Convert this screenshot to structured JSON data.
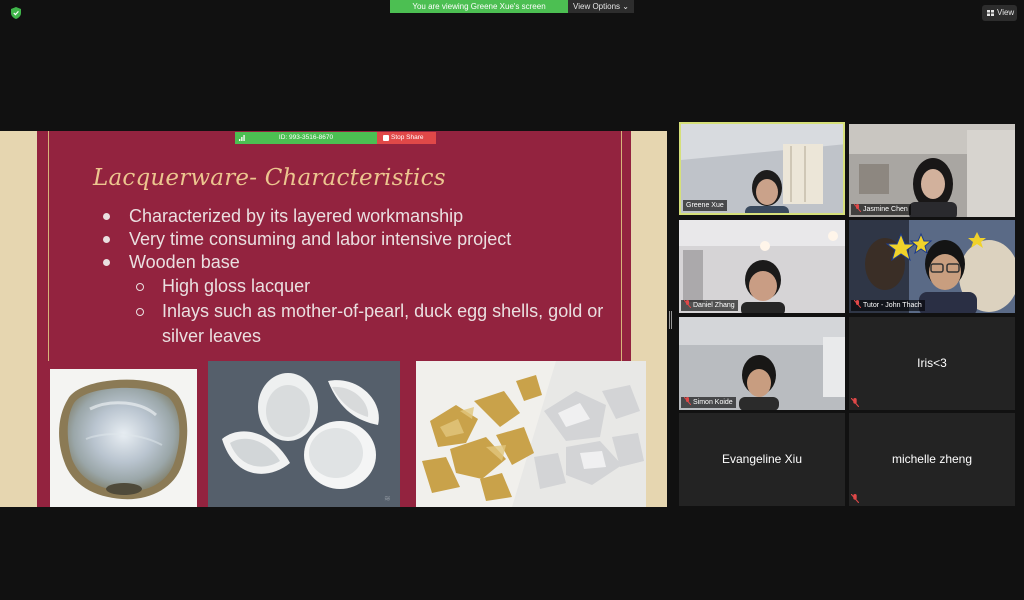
{
  "window": {
    "viewing_banner": "You are viewing Greene Xue's screen",
    "view_options_label": "View Options",
    "view_button_label": "View"
  },
  "share_toolbar": {
    "meeting_id": "ID: 993-3516-8670",
    "stop_share_label": "Stop Share"
  },
  "slide": {
    "title": "Lacquerware- Characteristics",
    "bullets": [
      "Characterized by its layered workmanship",
      "Very time consuming and labor intensive project",
      "Wooden base"
    ],
    "sub_bullets": [
      "High gloss lacquer",
      "Inlays such as mother-of-pearl, duck egg shells, gold or silver leaves"
    ]
  },
  "participants": [
    {
      "name": "Greene Xue",
      "active": true,
      "muted": false
    },
    {
      "name": "Jasmine Chen",
      "active": false,
      "muted": true
    },
    {
      "name": "Daniel Zhang",
      "active": false,
      "muted": true
    },
    {
      "name": "Tutor - John Thach",
      "active": false,
      "muted": true
    },
    {
      "name": "Simon Koide",
      "active": false,
      "muted": true
    },
    {
      "name": "Iris<3",
      "active": false,
      "muted": true
    },
    {
      "name": "Evangeline Xiu",
      "active": false,
      "muted": false
    },
    {
      "name": "michelle zheng",
      "active": false,
      "muted": true
    }
  ],
  "colors": {
    "slide_background": "#93233f",
    "slide_title": "#ecc58f",
    "banner_green": "#4cbf52",
    "stop_red": "#e04848",
    "active_speaker_border": "#d6e07a",
    "muted_mic": "#e04848"
  }
}
